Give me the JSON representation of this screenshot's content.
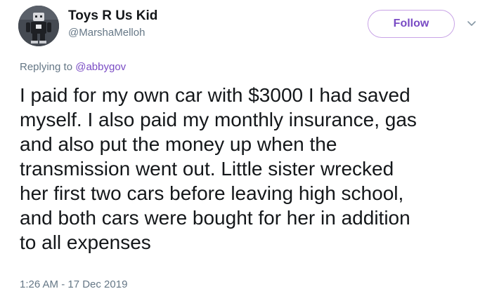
{
  "author": {
    "display_name": "Toys R Us Kid",
    "handle": "@MarshaMelloh",
    "avatar_icon": "robot-toy-avatar"
  },
  "actions": {
    "follow_label": "Follow",
    "more_icon": "chevron-down-icon"
  },
  "reply": {
    "prefix": "Replying to ",
    "mention": "@abbygov"
  },
  "tweet": {
    "lines": [
      "I paid for my own car with $3000 I had saved",
      "myself. I also paid my monthly insurance, gas",
      "and also put the money up when the",
      "transmission went out. Little sister wrecked",
      "her first two cars before leaving high school,",
      "and both cars were bought for her in addition",
      "to all expenses"
    ],
    "timestamp": "1:26 AM - 17 Dec 2019"
  },
  "colors": {
    "accent": "#794bc4",
    "text": "#14171a",
    "muted": "#657786"
  }
}
